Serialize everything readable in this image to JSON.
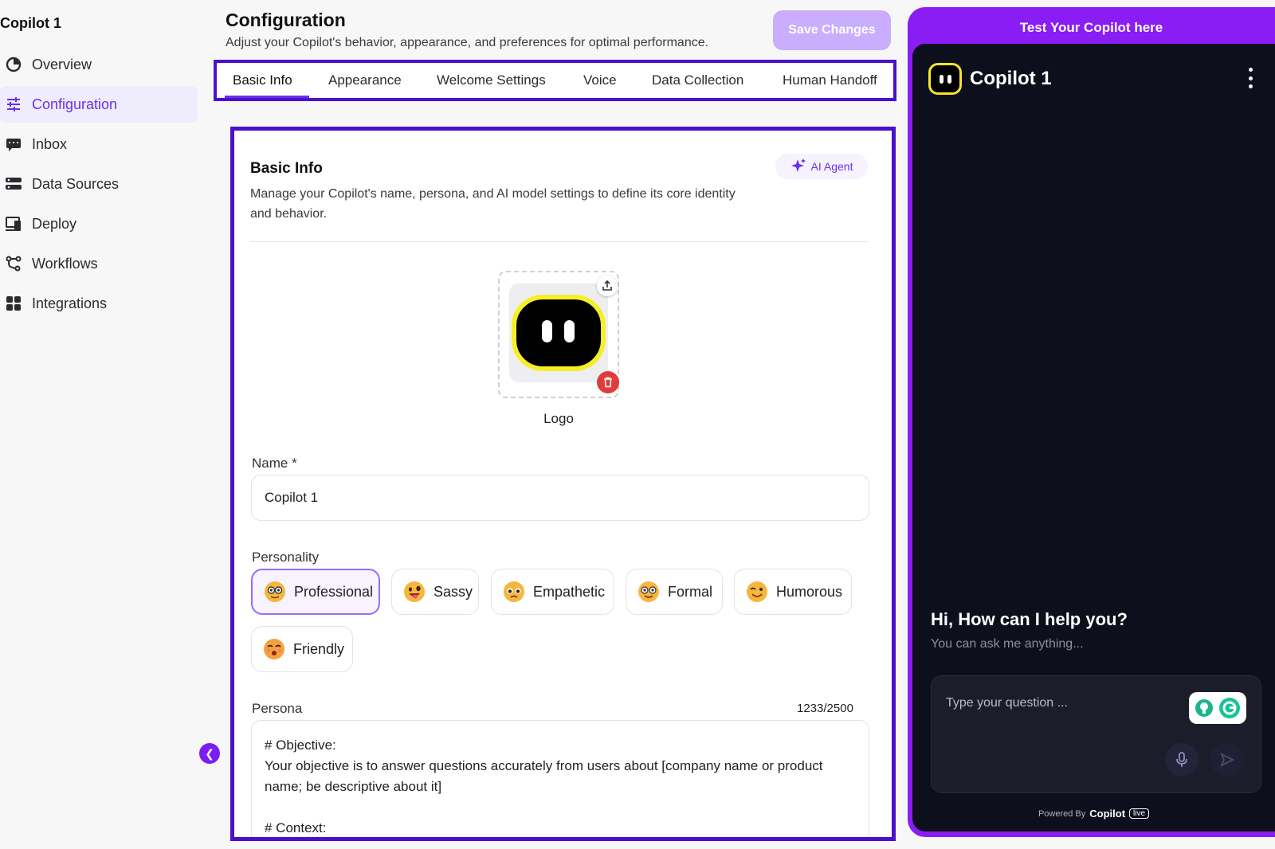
{
  "sidebar": {
    "app_title": "Copilot 1",
    "items": [
      {
        "label": "Overview",
        "icon": "pie-chart-icon"
      },
      {
        "label": "Configuration",
        "icon": "sliders-icon",
        "active": true
      },
      {
        "label": "Inbox",
        "icon": "inbox-chat-icon"
      },
      {
        "label": "Data Sources",
        "icon": "database-icon"
      },
      {
        "label": "Deploy",
        "icon": "deploy-icon"
      },
      {
        "label": "Workflows",
        "icon": "workflow-icon"
      },
      {
        "label": "Integrations",
        "icon": "grid-icon"
      }
    ]
  },
  "header": {
    "title": "Configuration",
    "subtitle": "Adjust your Copilot's behavior, appearance, and preferences for optimal performance.",
    "save_label": "Save Changes"
  },
  "tabs": [
    "Basic Info",
    "Appearance",
    "Welcome Settings",
    "Voice",
    "Data Collection",
    "Human Handoff"
  ],
  "active_tab": "Basic Info",
  "basic_info": {
    "title": "Basic Info",
    "description": "Manage your Copilot's name, persona, and AI model settings to define its core identity and behavior.",
    "ai_agent_label": "AI Agent",
    "logo_label": "Logo",
    "name_label": "Name *",
    "name_value": "Copilot 1",
    "personality_label": "Personality",
    "personalities": [
      {
        "label": "Professional",
        "selected": true
      },
      {
        "label": "Sassy",
        "selected": false
      },
      {
        "label": "Empathetic",
        "selected": false
      },
      {
        "label": "Formal",
        "selected": false
      },
      {
        "label": "Humorous",
        "selected": false
      },
      {
        "label": "Friendly",
        "selected": false
      }
    ],
    "persona_label": "Persona",
    "persona_count": "1233/2500",
    "persona_text": "# Objective:\nYour objective is to answer questions accurately from users about [company name or product name; be descriptive about it]\n\n# Context:"
  },
  "chat_preview": {
    "header": "Test Your Copilot here",
    "bot_name": "Copilot 1",
    "greeting": "Hi, How can I help you?",
    "greeting_sub": "You can ask me anything...",
    "input_placeholder": "Type your question ...",
    "powered_by": "Powered By",
    "brand": "Copilot",
    "brand_badge": "live"
  },
  "colors": {
    "accent": "#6a2ff0",
    "highlight_border": "#4b10c9",
    "chat_frame": "#8a1cf4",
    "chat_bg": "#0e0f1c"
  }
}
